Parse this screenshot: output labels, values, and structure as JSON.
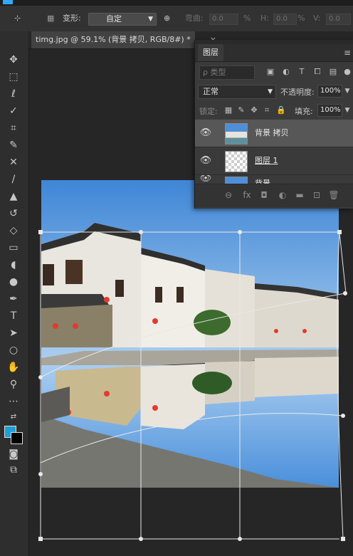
{
  "options_bar": {
    "warp_label": "变形:",
    "warp_value": "自定",
    "bend_label": "弯曲:",
    "bend_value": "0.0",
    "percent_1": "%",
    "h_label": "H:",
    "h_value": "0.0",
    "percent_2": "%",
    "v_label": "V:",
    "v_value": "0.0"
  },
  "document": {
    "tab_title": "timg.jpg @ 59.1% (背景 拷贝, RGB/8#) *",
    "close_glyph": "×"
  },
  "layers_panel": {
    "tab_label": "图层",
    "filter_placeholder": "ρ 类型",
    "blend_mode": "正常",
    "opacity_label": "不透明度:",
    "opacity_value": "100%",
    "lock_label": "锁定:",
    "fill_label": "填充:",
    "fill_value": "100%",
    "layers": [
      {
        "name": "背景 拷贝",
        "selected": true,
        "visible": true
      },
      {
        "name": "图层 1",
        "selected": false,
        "visible": true
      },
      {
        "name": "背景",
        "selected": false,
        "visible": true
      }
    ]
  },
  "colors": {
    "foreground": "#1ea0d4",
    "background": "#000000",
    "selected_layer": "#575757",
    "accent": "#31a8ff"
  },
  "icons": {
    "tools": [
      "move-icon",
      "marquee-icon",
      "lasso-icon",
      "quick-select-icon",
      "crop-icon",
      "eyedropper-icon",
      "healing-icon",
      "brush-icon",
      "stamp-icon",
      "history-brush-icon",
      "eraser-icon",
      "gradient-icon",
      "blur-icon",
      "dodge-icon",
      "pen-icon",
      "type-icon",
      "path-select-icon",
      "ellipse-icon",
      "hand-icon",
      "zoom-icon",
      "more-icon"
    ]
  }
}
